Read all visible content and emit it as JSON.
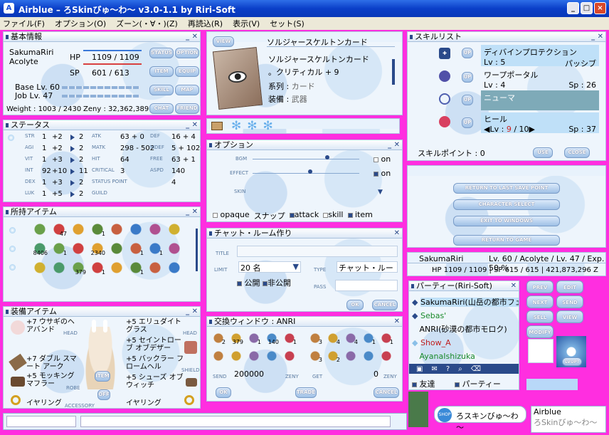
{
  "window": {
    "title": "Airblue – ろSkinびゅ～わ～ v3.0-1.1 by Riri-Soft"
  },
  "menu": [
    "ファイル(F)",
    "オプション(O)",
    "ズーン(・∀・)(Z)",
    "再読込(R)",
    "表示(V)",
    "セット(S)"
  ],
  "basic": {
    "title": "基本情報",
    "name": "SakumaRiri",
    "job": "Acolyte",
    "hp_label": "HP",
    "hp": "1109 / 1109",
    "sp_label": "SP",
    "sp": "601 / 613",
    "base": "Base Lv. 60",
    "joblv": "Job Lv. 47",
    "weight": "Weight : 1003 / 2430",
    "zeny": "Zeny : 32,362,389",
    "btns": [
      "STATUS",
      "OPTION",
      "ITEM",
      "EQUIP",
      "SKILL",
      "MAP",
      "CHAT",
      "FRIEND"
    ]
  },
  "card": {
    "view": "VIEW",
    "name": "ソルジャースケルトンカード",
    "desc1": "ソルジャースケルトンカード",
    "desc2": "。クリティカル + 9",
    "row1_label": "系列 :",
    "row1_value": "カード",
    "row2_label": "装備 :",
    "row2_value": "武器"
  },
  "skills": {
    "title": "スキルリスト",
    "items": [
      {
        "name": "ディバインプロテクション",
        "lv": "Lv : 5",
        "extra": "パッシブ"
      },
      {
        "name": "ワープポータル",
        "lv": "Lv : 4",
        "extra": "Sp : 26"
      },
      {
        "name": "ニューマ",
        "lv": "",
        "extra": ""
      },
      {
        "name": "ヒール",
        "lv_prefix": "Lv :",
        "lv_cur": "9",
        "lv_max": "/ 10",
        "extra": "Sp : 37"
      }
    ],
    "up": "UP",
    "points": "スキルポイント : 0",
    "use": "USE",
    "close": "CLOSE"
  },
  "status": {
    "title": "ステータス",
    "rows": [
      [
        "STR",
        "1",
        "+2",
        "2",
        "ATK",
        "63 + 0",
        "DEF",
        "16 + 4"
      ],
      [
        "AGI",
        "1",
        "+2",
        "2",
        "MATK",
        "298 - 502",
        "MDEF",
        "5 + 102"
      ],
      [
        "VIT",
        "1",
        "+3",
        "2",
        "HIT",
        "64",
        "FREE",
        "63 + 1"
      ],
      [
        "INT",
        "92",
        "+10",
        "11",
        "CRITICAL",
        "3",
        "ASPD",
        "140"
      ],
      [
        "DEX",
        "1",
        "+3",
        "2",
        "STATUS POINT",
        "",
        "",
        "4"
      ],
      [
        "LUK",
        "1",
        "+5",
        "2",
        "GUILD",
        "",
        "",
        ""
      ]
    ]
  },
  "options": {
    "title": "オプション",
    "bgm": "BGM",
    "effect": "EFFECT",
    "skin": "SKIN",
    "on1": "on",
    "on2": "on",
    "opaque": "opaque",
    "snap": "スナップ",
    "attack": "attack",
    "skill": "skill",
    "item": "item"
  },
  "items": {
    "title": "所持アイテム",
    "counts": [
      "47",
      "1",
      "8406",
      "1",
      "2340",
      "1",
      "1",
      "379",
      "1",
      "1"
    ]
  },
  "chat": {
    "title": "チャット・ルーム作り",
    "title_label": "TITLE",
    "limit_label": "LIMIT",
    "limit": "20 名",
    "type_label": "TYPE",
    "type": "チャット・ルー",
    "public": "公開",
    "private": "非公開",
    "pass": "PASS",
    "ok": "OK",
    "cancel": "CANCEL"
  },
  "menu_panel": {
    "btns": [
      "RETURN TO LAST SAVE POINT",
      "CHARACTER SELECT",
      "EXIT TO WINDOWS",
      "RETURN TO GAME"
    ]
  },
  "charinfo": {
    "name": "SakumaRiri",
    "lv": "Lv. 60 / Acolyte / Lv. 47 / Exp. 50 %",
    "hpsp": "HP 1109 / 1109 | SP 615 / 615 | 421,873,296 Z"
  },
  "equip": {
    "title": "装備アイテム",
    "left": [
      "+7 ウサギのヘアバンド",
      "+7 ダブル スマート アーク",
      "+5 モッキング マフラー",
      "イヤリング"
    ],
    "right": [
      "+5 エリュダイト グラス",
      "+5 セイントローブ オブデザー",
      "+5 バックラー フロームヘル",
      "+5 シューズ オブ ウィッチ",
      "イヤリング"
    ],
    "slots_l": [
      "HEAD",
      "",
      "ROBE",
      "ACCESSORY"
    ],
    "slots_r": [
      "HEAD",
      "BODY",
      "SHIELD",
      "SHOES",
      "ACCESSORY"
    ],
    "item": "ITEM",
    "off": "OFF"
  },
  "trade": {
    "title": "交換ウィンドウ : ANRI",
    "send": "SEND",
    "zeny_l": "200000",
    "zeny_label": "ZENY",
    "get": "GET",
    "zeny_r": "0",
    "ok": "OK",
    "trade": "TRADE",
    "cancel": "CANCEL",
    "counts_l": [
      "2",
      "379",
      "1",
      "140",
      "1"
    ],
    "counts_r": [
      "3",
      "4",
      "4",
      "1",
      "1",
      "3",
      "2"
    ]
  },
  "party": {
    "title": "パーティー(Riri-Soft)",
    "members": [
      "SakumaRiri(山岳の都市フェ",
      "Sebas'",
      "ANRI(砂漠の都市モロク)",
      "Show_A",
      "AyanaIshizuka"
    ],
    "friend": "友達",
    "party": "パーティー"
  },
  "mini": {
    "btns": [
      "PREV",
      "EDIT",
      "NEXT",
      "SEND",
      "SELL",
      "VIEW",
      "MODIFY"
    ],
    "lvup": "LVUP!"
  },
  "shop": {
    "label": "SHOP",
    "text": "ろスキンびゅ～わ～"
  },
  "airblue": {
    "a": "Airblue",
    "b": "ろSkinびゅ～わ～"
  }
}
